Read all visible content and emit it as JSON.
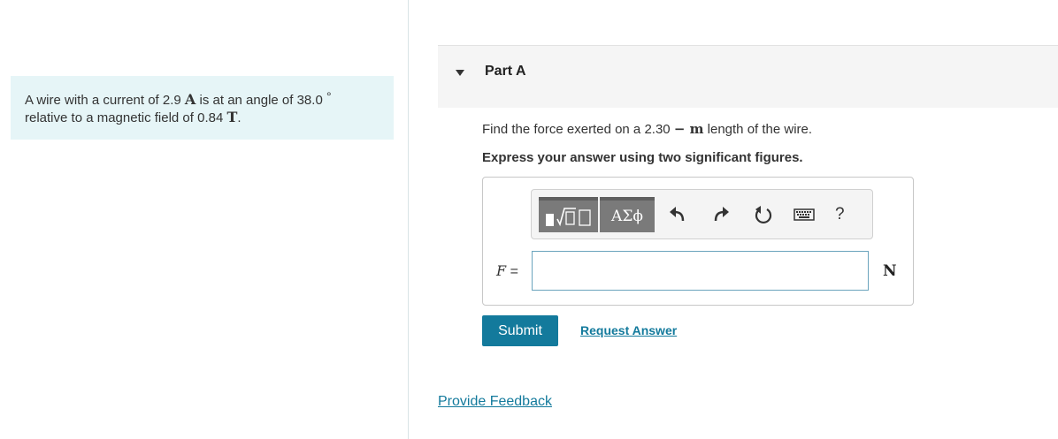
{
  "problem": {
    "text_1": "A wire with a current of 2.9",
    "current_unit": "A",
    "text_2": "is at an angle of 38.0",
    "degree_symbol": "°",
    "text_3": "relative to a magnetic field of 0.84",
    "field_unit": "T",
    "text_4": "."
  },
  "part": {
    "title": "Part A",
    "question_1": "Find the force exerted on a 2.30",
    "question_unit": "− m",
    "question_2": "length of the wire.",
    "instruction": "Express your answer using two significant figures."
  },
  "toolbar": {
    "greek_label": "ΑΣϕ",
    "help_label": "?",
    "icons": [
      "templates-icon",
      "undo-icon",
      "redo-icon",
      "reset-icon",
      "keyboard-icon",
      "help-icon"
    ]
  },
  "answer": {
    "variable": "F",
    "equals": "=",
    "value": "",
    "unit": "N"
  },
  "actions": {
    "submit_label": "Submit",
    "request_answer_label": "Request Answer",
    "feedback_label": "Provide Feedback"
  },
  "colors": {
    "accent": "#137a9c",
    "problem_bg": "#e6f5f7",
    "header_bg": "#f5f5f5"
  }
}
